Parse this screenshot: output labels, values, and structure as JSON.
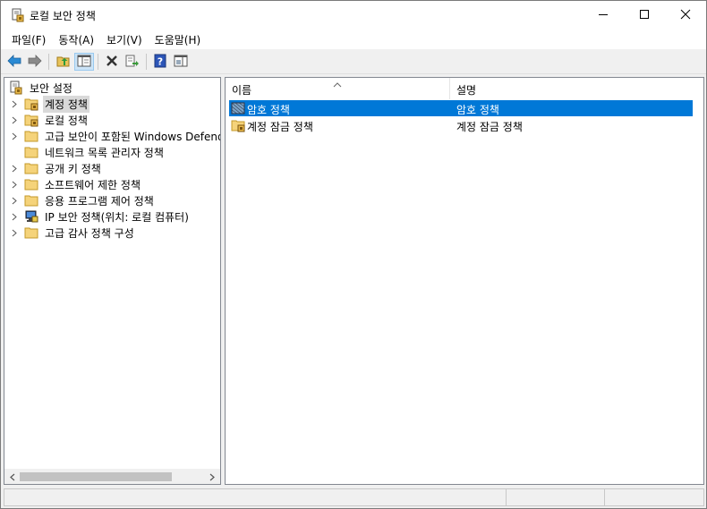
{
  "window": {
    "title": "로컬 보안 정책",
    "controls": {
      "minimize": "minimize-icon",
      "maximize": "maximize-icon",
      "close": "close-icon"
    }
  },
  "menu": {
    "items": [
      {
        "label": "파일(F)"
      },
      {
        "label": "동작(A)"
      },
      {
        "label": "보기(V)"
      },
      {
        "label": "도움말(H)"
      }
    ]
  },
  "toolbar": {
    "buttons": [
      {
        "icon": "back-arrow-icon"
      },
      {
        "icon": "forward-arrow-icon"
      },
      {
        "icon": "up-folder-icon"
      },
      {
        "icon": "show-hide-console-tree-icon"
      },
      {
        "icon": "delete-icon"
      },
      {
        "icon": "export-list-icon"
      },
      {
        "icon": "help-icon"
      },
      {
        "icon": "show-hide-action-pane-icon"
      }
    ]
  },
  "tree": {
    "root": {
      "label": "보안 설정"
    },
    "items": [
      {
        "label": "계정 정책",
        "selected": true,
        "icon": "folder-lock-icon"
      },
      {
        "label": "로컬 정책",
        "icon": "folder-lock-icon"
      },
      {
        "label": "고급 보안이 포함된 Windows Defend",
        "icon": "folder-icon"
      },
      {
        "label": "네트워크 목록 관리자 정책",
        "icon": "folder-icon"
      },
      {
        "label": "공개 키 정책",
        "icon": "folder-icon"
      },
      {
        "label": "소프트웨어 제한 정책",
        "icon": "folder-icon"
      },
      {
        "label": "응용 프로그램 제어 정책",
        "icon": "folder-icon"
      },
      {
        "label": "IP 보안 정책(위치: 로컬 컴퓨터)",
        "icon": "ip-security-icon"
      },
      {
        "label": "고급 감사 정책 구성",
        "icon": "folder-icon"
      }
    ]
  },
  "list": {
    "columns": [
      {
        "label": "이름"
      },
      {
        "label": "설명"
      }
    ],
    "rows": [
      {
        "name": "암호 정책",
        "description": "암호 정책",
        "selected": true,
        "icon": "policy-icon"
      },
      {
        "name": "계정 잠금 정책",
        "description": "계정 잠금 정책",
        "icon": "folder-lock-icon"
      }
    ]
  },
  "colors": {
    "selection": "#0078d7",
    "tree_selection": "#d9d9d9",
    "folder": "#f0c44c"
  }
}
